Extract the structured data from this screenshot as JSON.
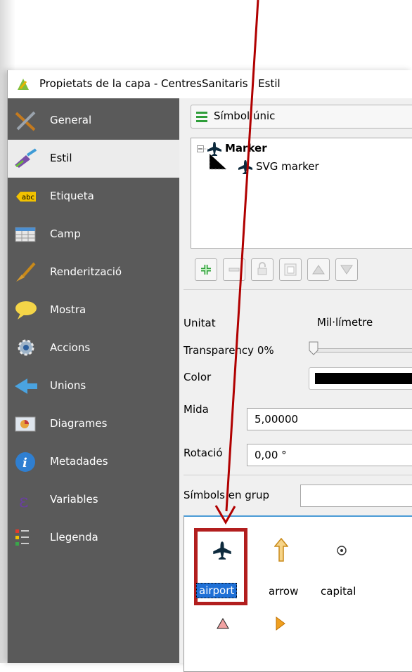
{
  "window": {
    "title": "Propietats de la capa - CentresSanitaris | Estil"
  },
  "sidebar": {
    "items": [
      {
        "label": "General",
        "icon": "tools-icon"
      },
      {
        "label": "Estil",
        "icon": "paintbrush-icon"
      },
      {
        "label": "Etiqueta",
        "icon": "abc-label-icon",
        "badge": "abc"
      },
      {
        "label": "Camp",
        "icon": "table-icon"
      },
      {
        "label": "Renderització",
        "icon": "brush-icon"
      },
      {
        "label": "Mostra",
        "icon": "speech-bubble-icon"
      },
      {
        "label": "Accions",
        "icon": "gear-icon"
      },
      {
        "label": "Unions",
        "icon": "join-arrow-icon"
      },
      {
        "label": "Diagrames",
        "icon": "chart-icon"
      },
      {
        "label": "Metadades",
        "icon": "info-icon"
      },
      {
        "label": "Variables",
        "icon": "epsilon-icon"
      },
      {
        "label": "Llegenda",
        "icon": "legend-icon"
      }
    ],
    "selected": "Estil"
  },
  "style": {
    "renderer": "Símbol únic",
    "tree": {
      "root": "Marker",
      "child": "SVG marker"
    },
    "unit_label": "Unitat",
    "unit_value": "Mil·límetre",
    "transparency_label": "Transparency 0%",
    "color_label": "Color",
    "color_value": "#000000",
    "size_label": "Mida",
    "size_value": "5,00000",
    "rotation_label": "Rotació",
    "rotation_value": "0,00 °",
    "group_label": "Símbols en grup",
    "group_value": ""
  },
  "symbols": [
    {
      "label": "airport",
      "selected": true
    },
    {
      "label": "arrow"
    },
    {
      "label": "capital"
    },
    {
      "label": ""
    },
    {
      "label": ""
    }
  ],
  "colors": {
    "annotation": "#b00000",
    "sidebar_bg": "#5a5a5a",
    "selection": "#1f70d6"
  }
}
